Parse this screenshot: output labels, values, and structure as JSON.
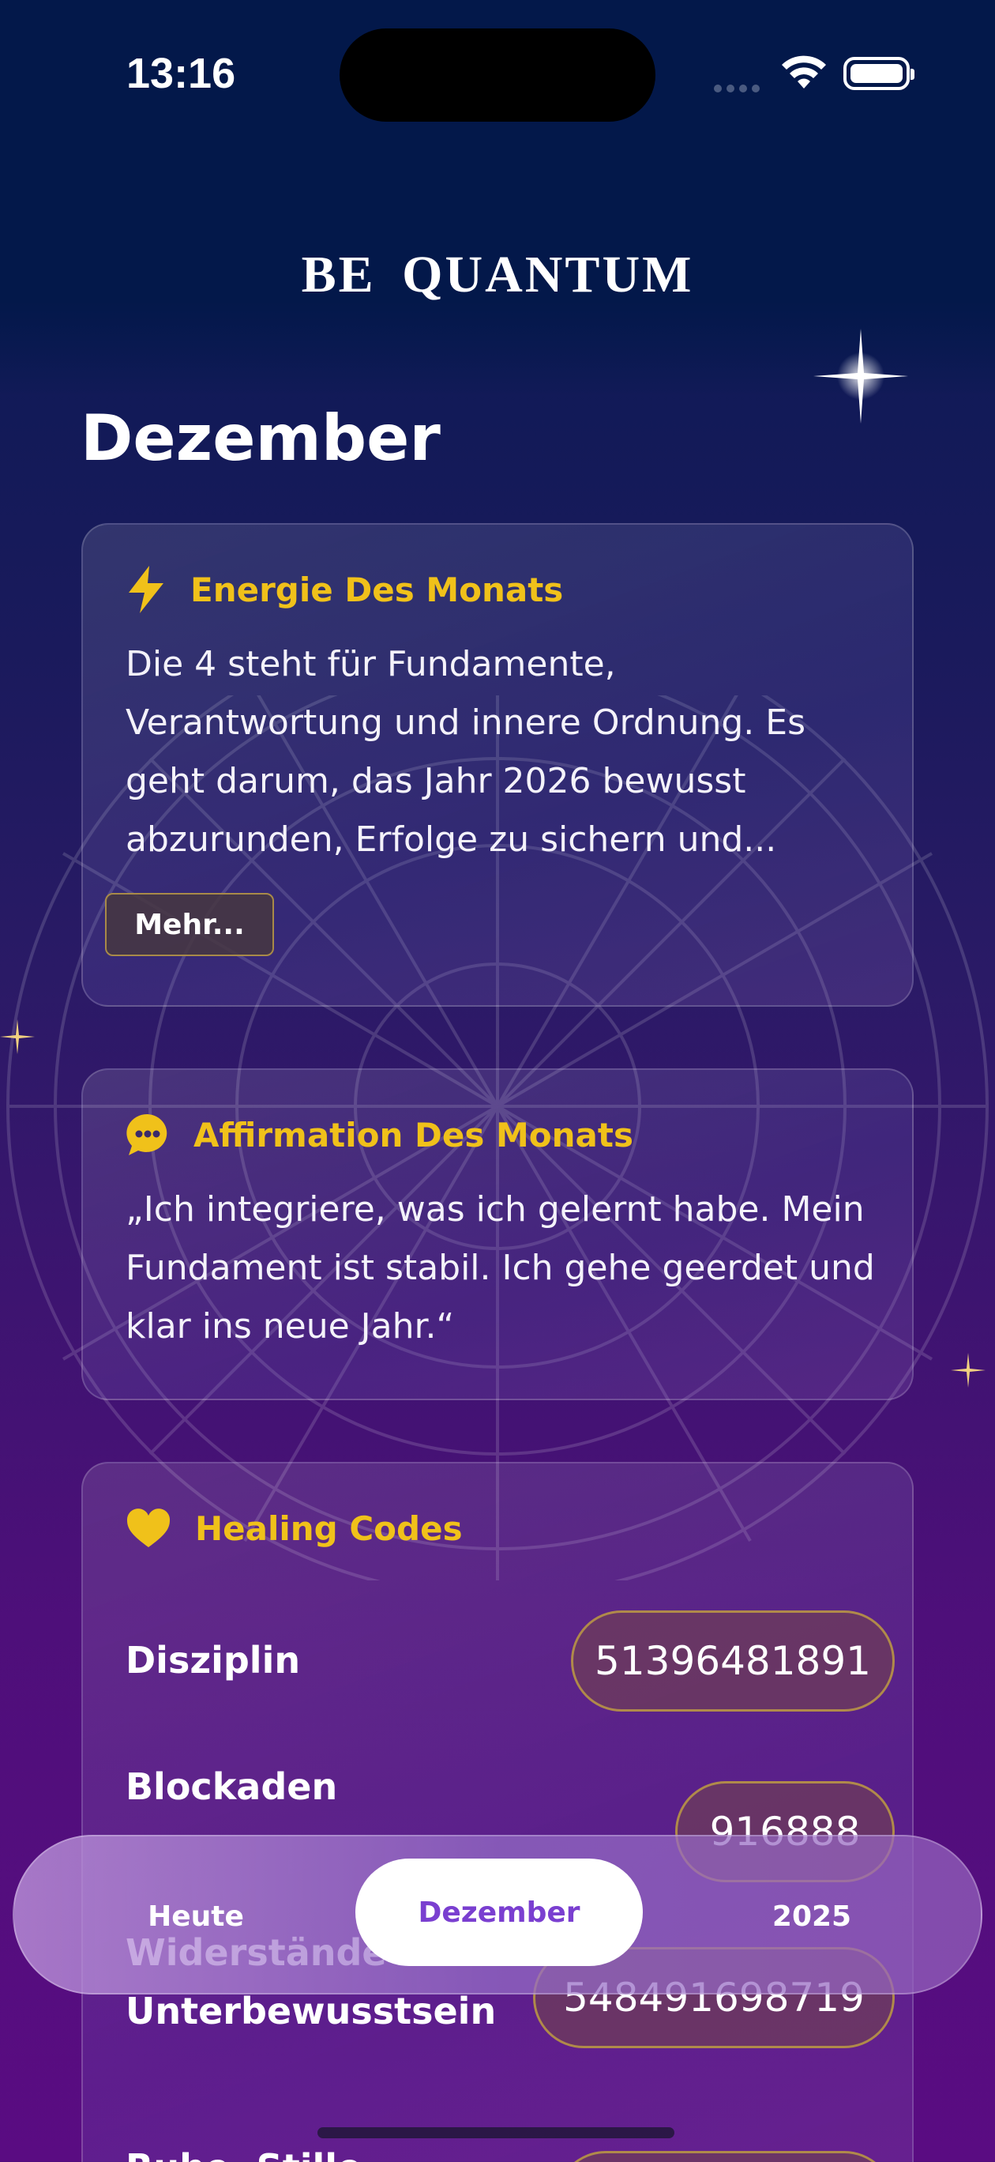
{
  "status_bar": {
    "time": "13:16"
  },
  "app": {
    "brand": "BE  QUANTUM"
  },
  "page": {
    "title": "Dezember"
  },
  "energy_card": {
    "title": "Energie Des Monats",
    "icon": "lightning-icon",
    "text": "Die 4 steht für Fundamente, Verantwortung und innere Ordnung. Es geht darum, das Jahr 2026 bewusst abzurunden, Erfolge zu sichern und...",
    "more_label": "Mehr..."
  },
  "affirmation_card": {
    "title": "Affirmation Des Monats",
    "icon": "chat-bubble-icon",
    "text": "„Ich integriere, was ich gelernt habe. Mein Fundament ist stabil. Ich gehe geerdet und klar ins neue Jahr.“"
  },
  "healing_card": {
    "title": "Healing Codes",
    "icon": "heart-icon",
    "codes": [
      {
        "label": "Disziplin",
        "code": "51396481891"
      },
      {
        "label": "Blockaden",
        "code": "916888"
      },
      {
        "label": "Widerstände im Unterbewusstsein",
        "code": "548491698719"
      },
      {
        "label": "Ruhe, Stille",
        "code": ""
      }
    ]
  },
  "tabbar": {
    "tabs": [
      {
        "label": "Heute",
        "active": false
      },
      {
        "label": "Dezember",
        "active": true
      },
      {
        "label": "2025",
        "active": false
      }
    ]
  },
  "colors": {
    "accent_gold": "#f0c11a",
    "tab_active_text": "#7a3fd0",
    "header_bg": "#03184a"
  }
}
